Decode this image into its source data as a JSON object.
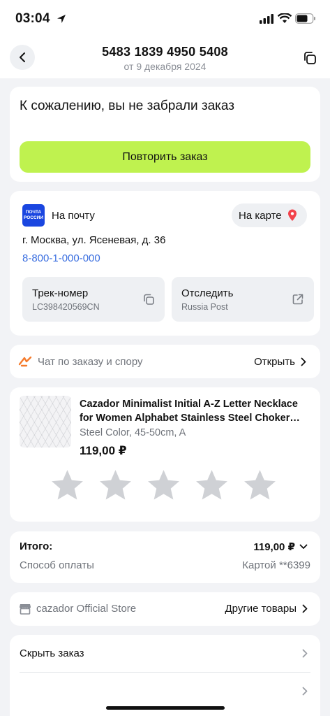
{
  "status_bar": {
    "time": "03:04"
  },
  "header": {
    "order_number": "5483 1839 4950 5408",
    "order_date": "от 9 декабря 2024"
  },
  "status_card": {
    "title": "К сожалению, вы не забрали заказ",
    "repeat_button": "Повторить заказ",
    "accent_color": "#bff24f"
  },
  "delivery": {
    "logo_text": "ПОЧТА РОССИИ",
    "type": "На почту",
    "map_button": "На карте",
    "address": "г. Москва, ул. Ясеневая, д. 36",
    "phone": "8-800-1-000-000",
    "track": {
      "label": "Трек-номер",
      "value": "LC398420569CN"
    },
    "follow": {
      "label": "Отследить",
      "value": "Russia Post"
    }
  },
  "chat": {
    "label": "Чат по заказу и спору",
    "open_link": "Открыть"
  },
  "product": {
    "title": "Cazador Minimalist Initial A-Z Letter Necklace for Women Alphabet Stainless Steel Choker…",
    "variant": "Steel Color, 45-50cm, A",
    "price": "119,00 ₽",
    "rating_stars": 5
  },
  "summary": {
    "total_label": "Итого:",
    "total_value": "119,00 ₽",
    "payment_label": "Способ оплаты",
    "payment_value": "Картой **6399"
  },
  "store": {
    "name": "cazador Official Store",
    "other_link": "Другие товары"
  },
  "actions": {
    "hide_order": "Скрыть заказ"
  }
}
